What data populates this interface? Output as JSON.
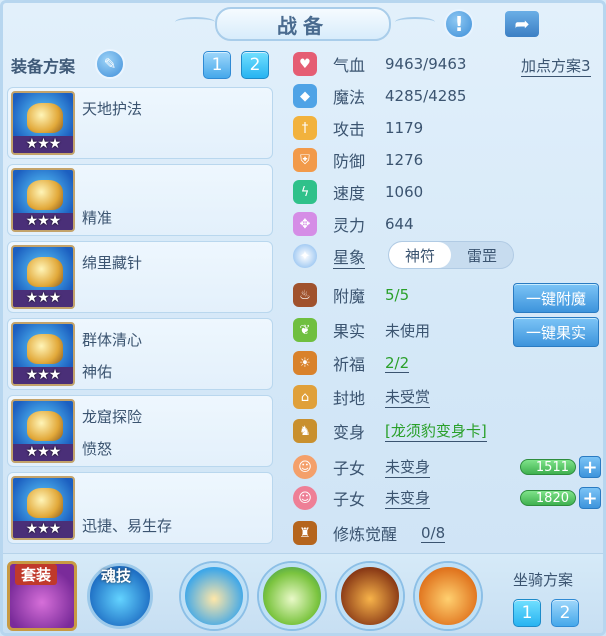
{
  "header": {
    "title": "战备",
    "alert_icon": "exclamation-icon",
    "share_icon": "share-arrow-icon"
  },
  "equip_plan": {
    "label": "装备方案",
    "edit_icon": "pencil-icon",
    "plans": [
      "1",
      "2"
    ],
    "active_plan": "2",
    "cards": [
      {
        "line1": "天地护法",
        "line2": "",
        "stars": "★★★"
      },
      {
        "line1": "",
        "line2": "精准",
        "stars": "★★★"
      },
      {
        "line1": "绵里藏针",
        "line2": "",
        "stars": "★★★"
      },
      {
        "line1": "群体清心",
        "line2": "神佑",
        "stars": "★★★"
      },
      {
        "line1": "龙窟探险",
        "line2": "愤怒",
        "stars": "★★★"
      },
      {
        "line1": "",
        "line2": "迅捷、易生存",
        "stars": "★★★"
      }
    ]
  },
  "stats": {
    "plan_link": "加点方案3",
    "rows": [
      {
        "label": "气血",
        "value": "9463/9463"
      },
      {
        "label": "魔法",
        "value": "4285/4285"
      },
      {
        "label": "攻击",
        "value": "1179"
      },
      {
        "label": "防御",
        "value": "1276"
      },
      {
        "label": "速度",
        "value": "1060"
      },
      {
        "label": "灵力",
        "value": "644"
      }
    ],
    "star_label": "星象",
    "toggle": {
      "on": "神符",
      "off": "雷罡"
    }
  },
  "extras": {
    "enchant": {
      "label": "附魔",
      "value": "5/5",
      "button": "一键附魔"
    },
    "fruit": {
      "label": "果实",
      "value": "未使用",
      "button": "一键果实"
    },
    "blessing": {
      "label": "祈福",
      "value": "2/2"
    },
    "fief": {
      "label": "封地",
      "value": "未受赏"
    },
    "transform": {
      "label": "变身",
      "value": "[龙须豹变身卡]"
    },
    "child1": {
      "label": "子女",
      "value": "未变身",
      "bar": "1511"
    },
    "child2": {
      "label": "子女",
      "value": "未变身",
      "bar": "1820"
    },
    "awaken": {
      "label": "修炼觉醒",
      "value": "0/8"
    }
  },
  "bottom": {
    "suit_label": "套装",
    "soul_label": "魂技",
    "mount_label": "坐骑方案",
    "mount_plans": [
      "1",
      "2"
    ]
  },
  "colors": {
    "accent": "#3d94dc",
    "green": "#2aa02a",
    "background": "#d9ecfa"
  }
}
